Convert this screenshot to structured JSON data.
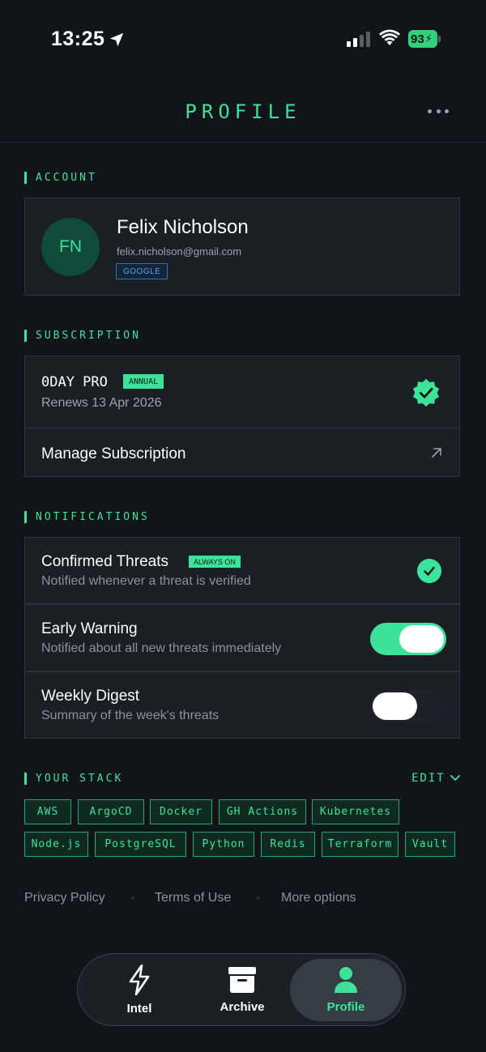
{
  "status_bar": {
    "time": "13:25",
    "battery": "93"
  },
  "header": {
    "title": "PROFILE"
  },
  "account": {
    "section_label": "ACCOUNT",
    "initials": "FN",
    "name": "Felix Nicholson",
    "email": "felix.nicholson@gmail.com",
    "provider": "GOOGLE"
  },
  "subscription": {
    "section_label": "SUBSCRIPTION",
    "plan": "0DAY PRO",
    "plan_badge": "ANNUAL",
    "renews": "Renews 13 Apr 2026",
    "manage_label": "Manage Subscription"
  },
  "notifications": {
    "section_label": "NOTIFICATIONS",
    "items": [
      {
        "title": "Confirmed Threats",
        "badge": "ALWAYS ON",
        "subtitle": "Notified whenever a threat is verified",
        "control": "check"
      },
      {
        "title": "Early Warning",
        "subtitle": "Notified about all new threats immediately",
        "control": "toggle",
        "enabled": true
      },
      {
        "title": "Weekly Digest",
        "subtitle": "Summary of the week's threats",
        "control": "toggle",
        "enabled": false
      }
    ]
  },
  "stack": {
    "section_label": "YOUR STACK",
    "edit_label": "EDIT",
    "chips": [
      "AWS",
      "ArgoCD",
      "Docker",
      "GH Actions",
      "Kubernetes",
      "Node.js",
      "PostgreSQL",
      "Python",
      "Redis",
      "Terraform",
      "Vault"
    ]
  },
  "footer": {
    "privacy": "Privacy Policy",
    "terms": "Terms of Use",
    "more": "More options",
    "separator": "·"
  },
  "tabbar": {
    "items": [
      {
        "label": "Intel",
        "icon": "bolt-icon",
        "active": false
      },
      {
        "label": "Archive",
        "icon": "archive-icon",
        "active": false
      },
      {
        "label": "Profile",
        "icon": "person-icon",
        "active": true
      }
    ]
  },
  "colors": {
    "accent": "#3ee39b",
    "background": "#111519",
    "card": "#1a1f24",
    "google_badge": "#5aa0f0"
  }
}
